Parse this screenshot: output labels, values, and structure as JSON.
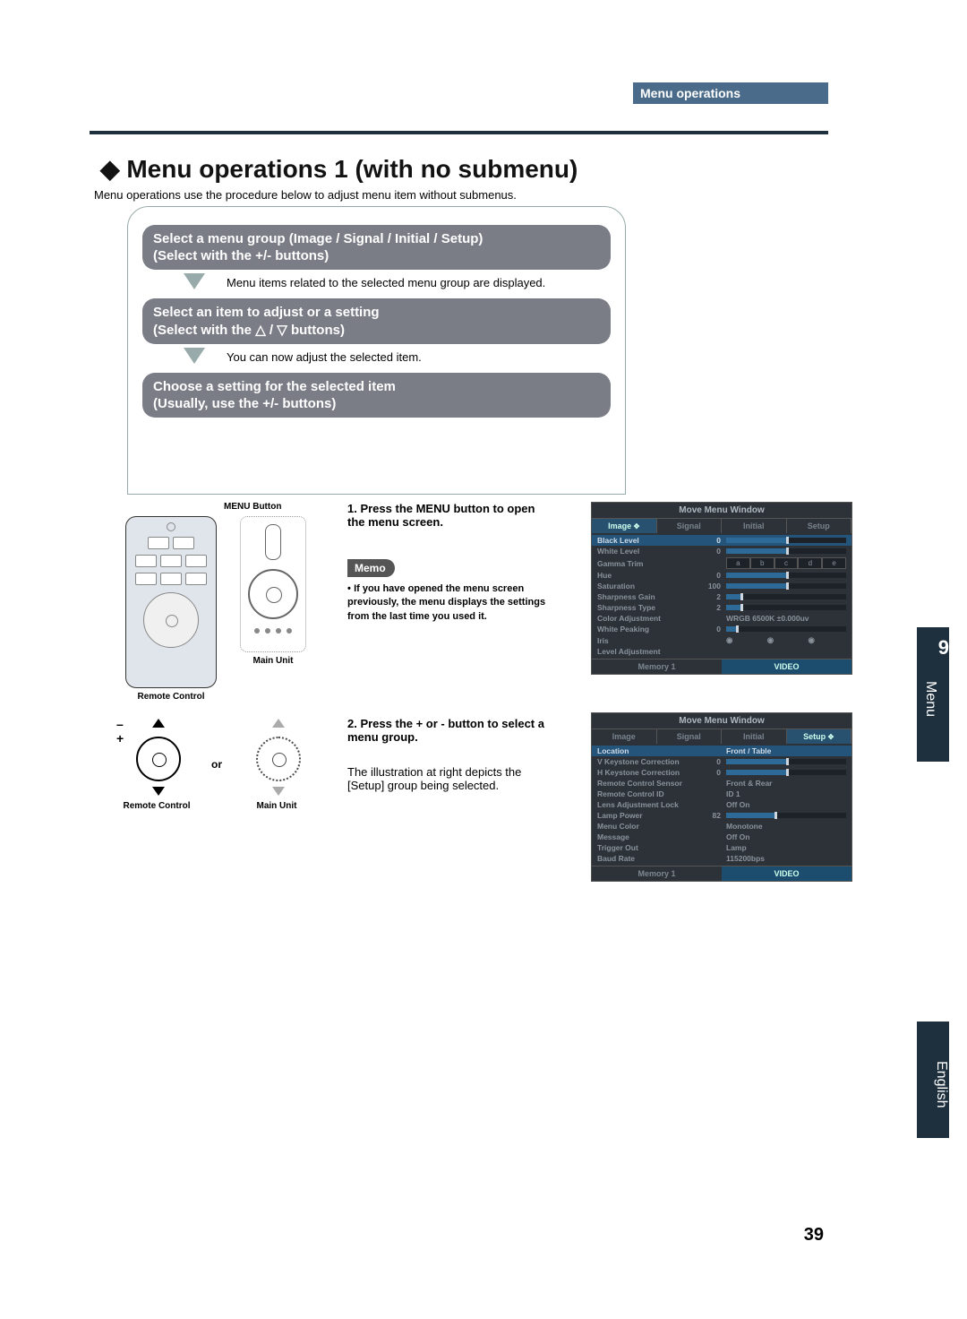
{
  "header": {
    "section": "Menu operations"
  },
  "title_diamond": "◆",
  "title": "Menu operations 1 (with no submenu)",
  "intro": "Menu operations use the procedure below to adjust menu item without submenus.",
  "flow": {
    "step1a": "Select a menu group (Image / Signal / Initial / Setup)",
    "step1b": "(Select with the +/- buttons)",
    "note1": "Menu items related to the selected menu group are displayed.",
    "step2a": "Select an item to adjust or a setting",
    "step2b_pre": "(Select with the ",
    "step2b_mid": " / ",
    "step2b_post": " buttons)",
    "note2": "You can now adjust the selected item.",
    "step3a": "Choose a setting for the selected item",
    "step3b": "(Usually, use the +/- buttons)"
  },
  "labels": {
    "menu_button": "MENU Button",
    "remote_control": "Remote Control",
    "main_unit": "Main Unit",
    "or": "or",
    "memo": "Memo"
  },
  "steps": {
    "s1": "1.   Press the MENU button to open the menu screen.",
    "memo1": "If you have opened the menu screen previously, the menu displays the settings from the last time you used it.",
    "s2": "2.   Press the + or - button to select a menu group.",
    "s2_body": "The illustration at right depicts the [Setup] group being selected."
  },
  "osd1": {
    "title": "Move Menu Window",
    "tabs": [
      "Image",
      "Signal",
      "Initial",
      "Setup"
    ],
    "active_tab": 0,
    "rows": [
      {
        "label": "Black Level",
        "val": "0",
        "type": "slider",
        "pct": 50
      },
      {
        "label": "White Level",
        "val": "0",
        "type": "slider",
        "pct": 50
      },
      {
        "label": "Gamma Trim",
        "val": "",
        "type": "seg",
        "seg": [
          "a",
          "b",
          "c",
          "d",
          "e"
        ]
      },
      {
        "label": "Hue",
        "val": "0",
        "type": "slider",
        "pct": 50
      },
      {
        "label": "Saturation",
        "val": "100",
        "type": "slider",
        "pct": 50
      },
      {
        "label": "Sharpness Gain",
        "val": "2",
        "type": "slider",
        "pct": 12
      },
      {
        "label": "Sharpness Type",
        "val": "2",
        "type": "slider",
        "pct": 12
      },
      {
        "label": "Color Adjustment",
        "val": "",
        "type": "txt",
        "txt": "WRGB          6500K ±0.000uv"
      },
      {
        "label": "White Peaking",
        "val": "0",
        "type": "slider",
        "pct": 8
      },
      {
        "label": "Iris",
        "val": "",
        "type": "icons"
      },
      {
        "label": "Level Adjustment",
        "val": "",
        "type": "none"
      }
    ],
    "foot": [
      "Memory 1",
      "VIDEO"
    ]
  },
  "osd2": {
    "title": "Move Menu Window",
    "tabs": [
      "Image",
      "Signal",
      "Initial",
      "Setup"
    ],
    "active_tab": 3,
    "rows": [
      {
        "label": "Location",
        "val": "",
        "type": "txt",
        "txt": "Front / Table"
      },
      {
        "label": "V Keystone Correction",
        "val": "0",
        "type": "slider",
        "pct": 50
      },
      {
        "label": "H Keystone Correction",
        "val": "0",
        "type": "slider",
        "pct": 50
      },
      {
        "label": "Remote Control Sensor",
        "val": "",
        "type": "txt",
        "txt": "Front & Rear"
      },
      {
        "label": "Remote Control ID",
        "val": "",
        "type": "txt",
        "txt": "ID 1"
      },
      {
        "label": "Lens Adjustment Lock",
        "val": "",
        "type": "txt",
        "txt": "Off            On"
      },
      {
        "label": "Lamp Power",
        "val": "82",
        "type": "slider",
        "pct": 40
      },
      {
        "label": "Menu Color",
        "val": "",
        "type": "txt",
        "txt": "Monotone"
      },
      {
        "label": "Message",
        "val": "",
        "type": "txt",
        "txt": "Off            On"
      },
      {
        "label": "Trigger Out",
        "val": "",
        "type": "txt",
        "txt": "Lamp"
      },
      {
        "label": "Baud Rate",
        "val": "",
        "type": "txt",
        "txt": "115200bps"
      }
    ],
    "foot": [
      "Memory 1",
      "VIDEO"
    ]
  },
  "side": {
    "chapter_num": "9",
    "chapter": "Menu",
    "lang": "English"
  },
  "page_number": "39"
}
